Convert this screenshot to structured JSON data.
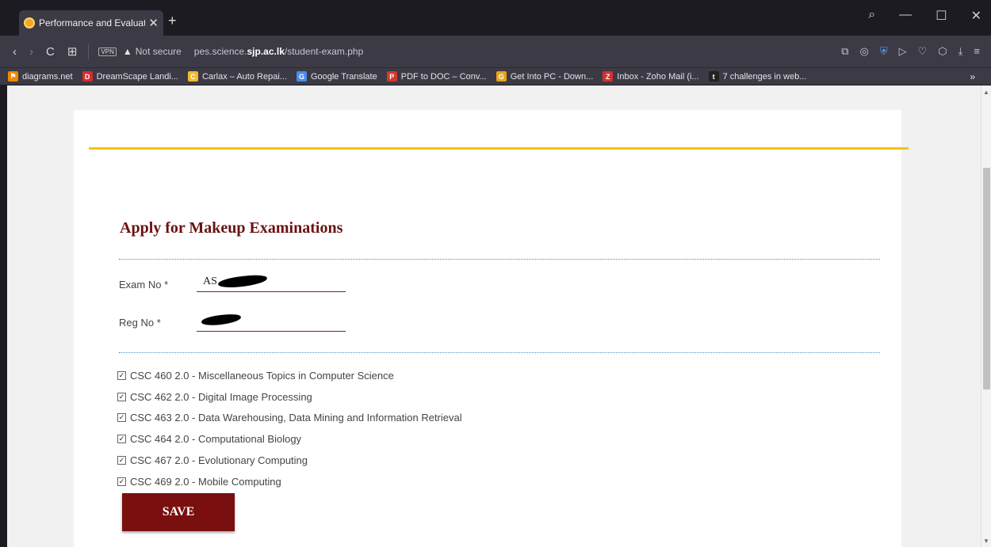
{
  "browser": {
    "tab_title": "Performance and Evaluatio",
    "tab_close": "✕",
    "new_tab": "+",
    "window_controls": [
      "⌕",
      "—",
      "☐",
      "✕"
    ],
    "nav": {
      "back": "‹",
      "forward": "›",
      "reload": "C",
      "grid": "⊞"
    },
    "vpn_label": "VPN",
    "warning_icon": "▲",
    "security_label": "Not secure",
    "url_prefix": "pes.science.",
    "url_domain": "sjp.ac.lk",
    "url_path": "/student-exam.php",
    "addr_icons": [
      "⧉",
      "◎",
      "⛨",
      "▷",
      "♡",
      "⬡",
      "⤓",
      "≡"
    ],
    "bookmarks": [
      {
        "label": "diagrams.net",
        "icon": "⚑",
        "color": "#f08705"
      },
      {
        "label": "DreamScape Landi...",
        "icon": "D",
        "color": "#d62b2b"
      },
      {
        "label": "Carlax – Auto Repai...",
        "icon": "C",
        "color": "#f2b92e"
      },
      {
        "label": "Google Translate",
        "icon": "G",
        "color": "#4a8cf0"
      },
      {
        "label": "PDF to DOC – Conv...",
        "icon": "P",
        "color": "#d43a2a"
      },
      {
        "label": "Get Into PC - Down...",
        "icon": "G",
        "color": "#e8a415"
      },
      {
        "label": "Inbox - Zoho Mail (i...",
        "icon": "Z",
        "color": "#d63030"
      },
      {
        "label": "7 challenges in web...",
        "icon": "t",
        "color": "#222222"
      }
    ],
    "bookmarks_more": "»"
  },
  "page": {
    "heading": "Apply for Makeup Examinations",
    "exam_no_label": "Exam No *",
    "exam_no_value": "AS",
    "reg_no_label": "Reg No *",
    "reg_no_value": "",
    "courses": [
      "CSC 460 2.0 - Miscellaneous Topics in Computer Science",
      "CSC 462 2.0 - Digital Image Processing",
      "CSC 463 2.0 - Data Warehousing, Data Mining and Information Retrieval",
      "CSC 464 2.0 - Computational Biology",
      "CSC 467 2.0 - Evolutionary Computing",
      "CSC 469 2.0 - Mobile Computing"
    ],
    "checkmark": "✓",
    "save_label": "SAVE"
  },
  "colors": {
    "heading": "#6b1111",
    "accent_rule": "#f3c400",
    "save_button": "#7a0f0f"
  }
}
